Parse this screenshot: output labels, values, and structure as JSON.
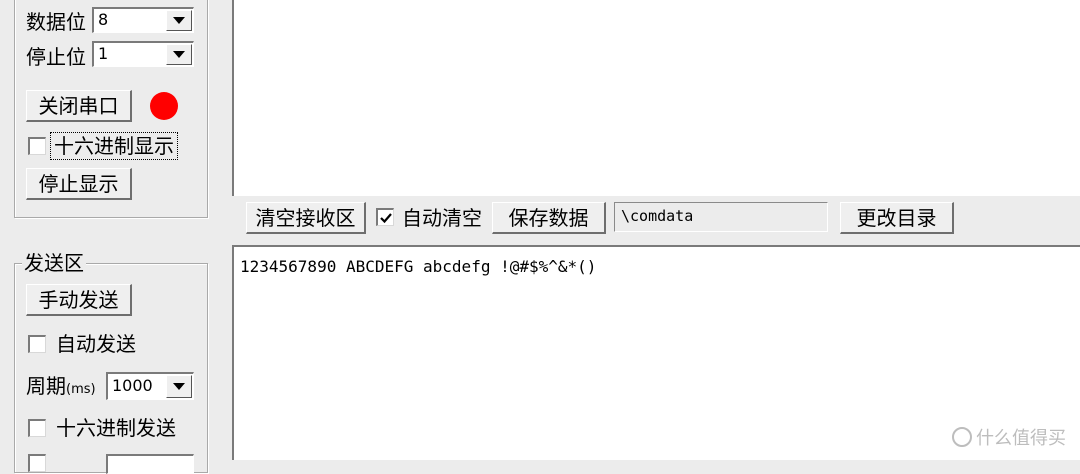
{
  "serial_settings": {
    "data_bits_label": "数据位",
    "data_bits_value": "8",
    "stop_bits_label": "停止位",
    "stop_bits_value": "1",
    "close_port_label": "关闭串口",
    "port_status_color": "#ff0000",
    "hex_display_label": "十六进制显示",
    "hex_display_checked": false,
    "stop_display_label": "停止显示"
  },
  "receive_toolbar": {
    "clear_receive_label": "清空接收区",
    "auto_clear_label": "自动清空",
    "auto_clear_checked": true,
    "save_data_label": "保存数据",
    "path_value": "\\comdata",
    "change_dir_label": "更改目录"
  },
  "send_area": {
    "legend": "发送区",
    "manual_send_label": "手动发送",
    "auto_send_label": "自动发送",
    "auto_send_checked": false,
    "period_label": "周期",
    "period_unit": "(ms)",
    "period_value": "1000",
    "hex_send_label": "十六进制发送",
    "hex_send_checked": false
  },
  "send_text": "1234567890 ABCDEFG abcdefg !@#$%^&*()",
  "watermark": "什么值得买"
}
